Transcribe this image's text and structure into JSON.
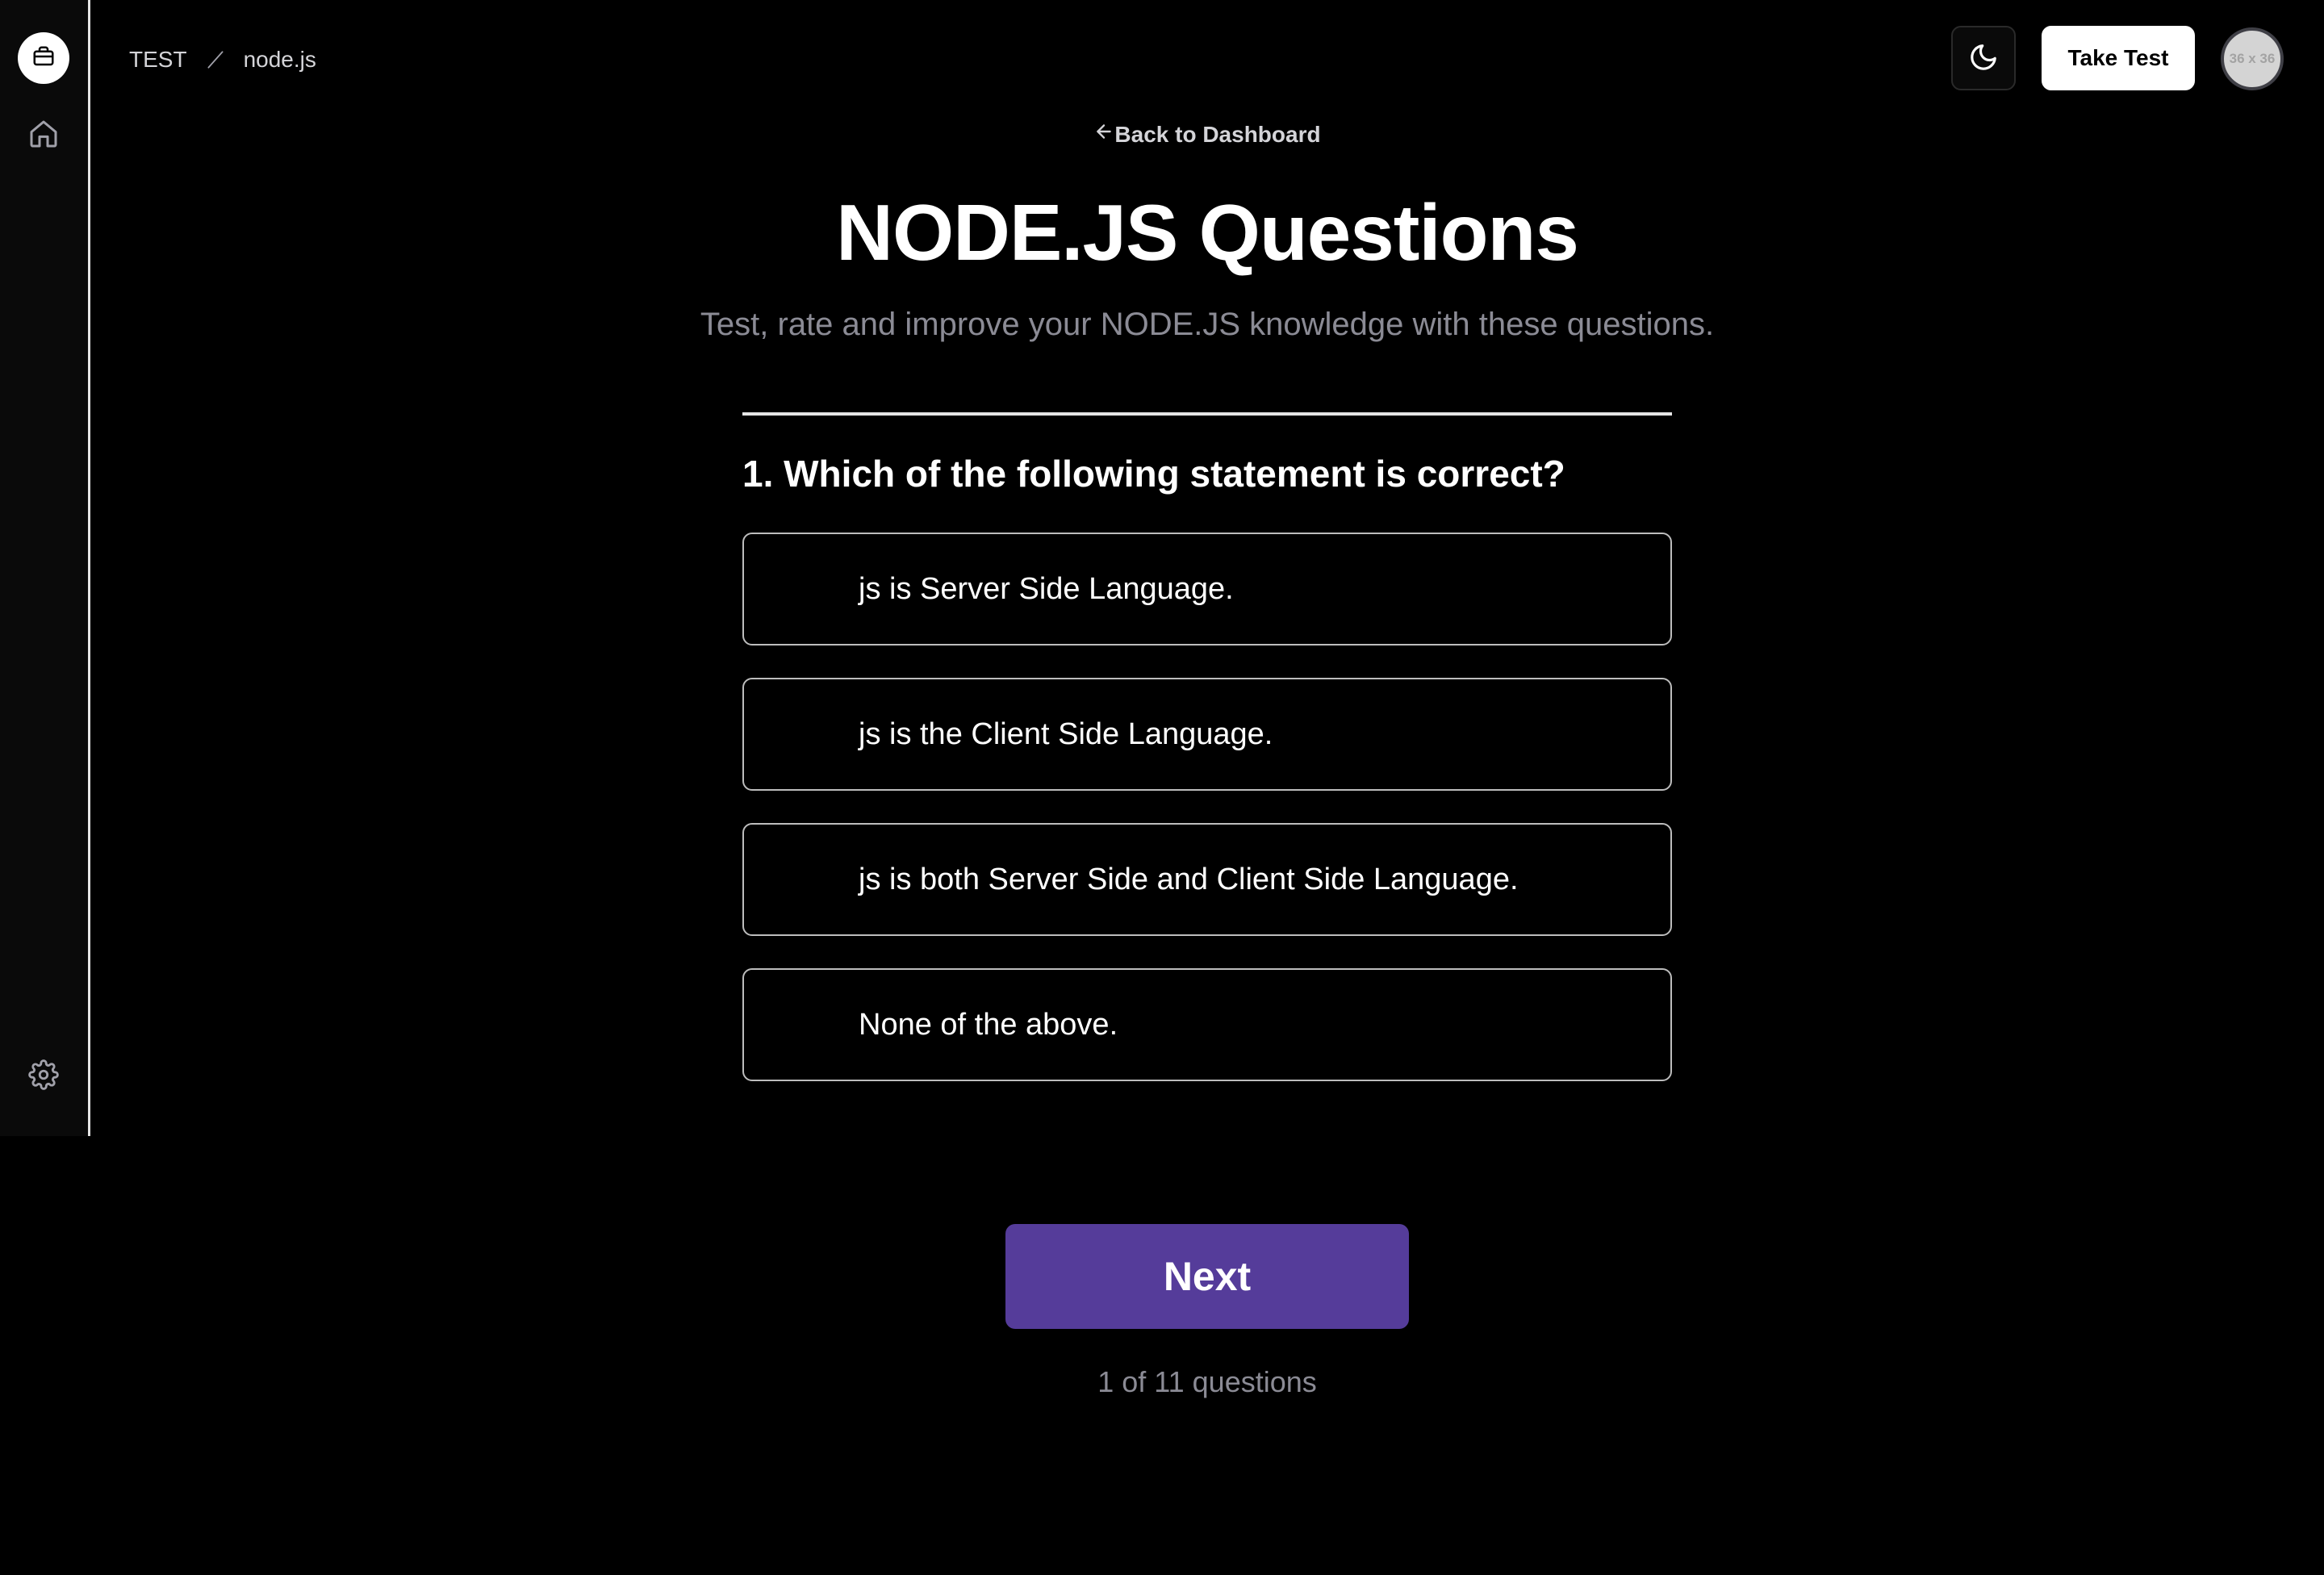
{
  "sidebar": {
    "logo_icon": "briefcase-icon",
    "items": [
      {
        "icon": "home-icon"
      },
      {
        "icon": "gear-icon"
      }
    ]
  },
  "header": {
    "breadcrumb": [
      "TEST",
      "node.js"
    ],
    "theme_icon": "moon-icon",
    "take_test_label": "Take Test",
    "avatar_placeholder": "36 x 36"
  },
  "main": {
    "back_label": "Back to Dashboard",
    "title": "NODE.JS Questions",
    "subtitle": "Test, rate and improve your NODE.JS knowledge with these questions.",
    "question": "1. Which of the following statement is correct?",
    "options": [
      "js is Server Side Language.",
      "js is the Client Side Language.",
      "js is both Server Side and Client Side Language.",
      "None of the above."
    ],
    "next_label": "Next",
    "progress": "1 of 11 questions"
  },
  "colors": {
    "background": "#000000",
    "accent": "#553c9a",
    "muted_text": "#8b8b95"
  }
}
